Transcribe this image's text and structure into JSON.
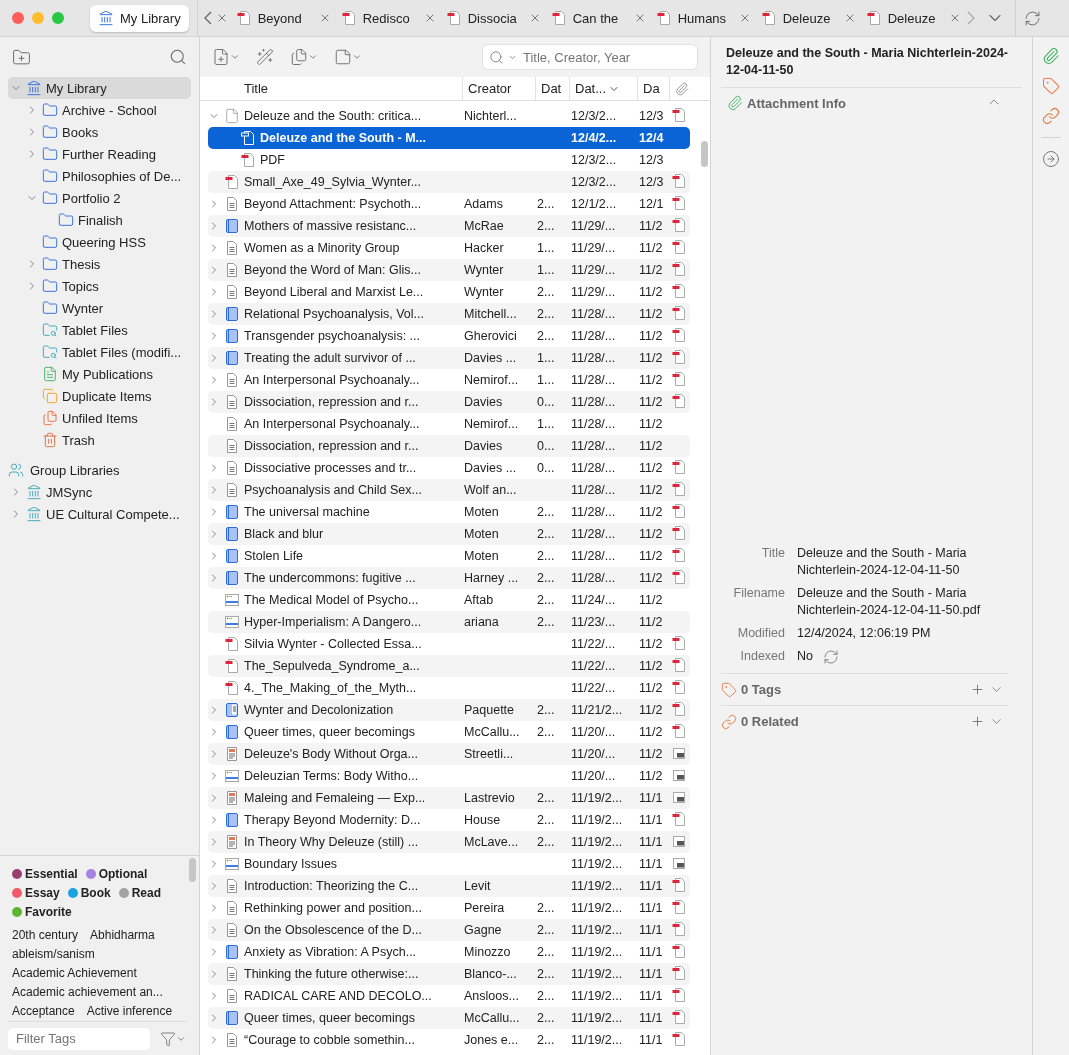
{
  "tabs": [
    {
      "label": "My Library",
      "kind": "library",
      "selected": true
    },
    {
      "label": "Beyond",
      "kind": "pdf",
      "selected": false
    },
    {
      "label": "Redisco",
      "kind": "pdf",
      "selected": false
    },
    {
      "label": "Dissocia",
      "kind": "pdf",
      "selected": false
    },
    {
      "label": "Can the",
      "kind": "pdf",
      "selected": false
    },
    {
      "label": "Humans",
      "kind": "pdf",
      "selected": false
    },
    {
      "label": "Deleuze",
      "kind": "pdf",
      "selected": false
    },
    {
      "label": "Deleuze",
      "kind": "pdf",
      "selected": false
    }
  ],
  "collections": [
    {
      "label": "My Library",
      "kind": "library",
      "selected": true,
      "expanded": true,
      "children": [
        {
          "label": "Archive - School",
          "kind": "folder",
          "selected": false,
          "expanded": false
        },
        {
          "label": "Books",
          "kind": "folder",
          "selected": false,
          "expanded": false
        },
        {
          "label": "Further Reading",
          "kind": "folder",
          "selected": false,
          "expanded": false
        },
        {
          "label": "Philosophies of De...",
          "kind": "folder",
          "selected": false
        },
        {
          "label": "Portfolio 2",
          "kind": "folder",
          "selected": false,
          "expanded": true,
          "children": [
            {
              "label": "Finalish",
              "kind": "folder",
              "selected": false
            }
          ]
        },
        {
          "label": "Queering HSS",
          "kind": "folder",
          "selected": false
        },
        {
          "label": "Thesis",
          "kind": "folder",
          "selected": false,
          "expanded": false
        },
        {
          "label": "Topics",
          "kind": "folder",
          "selected": false,
          "expanded": false
        },
        {
          "label": "Wynter",
          "kind": "folder",
          "selected": false
        },
        {
          "label": "Tablet Files",
          "kind": "saved-search",
          "selected": false
        },
        {
          "label": "Tablet Files (modifi...",
          "kind": "saved-search",
          "selected": false
        },
        {
          "label": "My Publications",
          "kind": "publications",
          "selected": false
        },
        {
          "label": "Duplicate Items",
          "kind": "duplicates",
          "selected": false
        },
        {
          "label": "Unfiled Items",
          "kind": "unfiled",
          "selected": false
        },
        {
          "label": "Trash",
          "kind": "trash",
          "selected": false
        }
      ]
    }
  ],
  "group_libraries": {
    "label": "Group Libraries",
    "items": [
      {
        "label": "JMSync",
        "selected": false,
        "expanded": false
      },
      {
        "label": "UE Cultural Compete...",
        "selected": false,
        "expanded": false
      }
    ]
  },
  "tag_selector": {
    "colored_tags": [
      {
        "label": "Essential",
        "color": "#9c3d72"
      },
      {
        "label": "Optional",
        "color": "#a584e0"
      },
      {
        "label": "Essay",
        "color": "#f25c68"
      },
      {
        "label": "Book",
        "color": "#1aa3e0"
      },
      {
        "label": "Read",
        "color": "#a3a3a3"
      },
      {
        "label": "Favorite",
        "color": "#5cb532"
      }
    ],
    "tags": [
      "20th century",
      "Abhidharma",
      "ableism/sanism",
      "Academic Achievement",
      "Academic achievement an...",
      "Acceptance",
      "Active inference"
    ],
    "filter": {
      "placeholder": "Filter Tags"
    }
  },
  "items": {
    "search": {
      "placeholder": "Title, Creator, Year"
    },
    "columns": [
      {
        "label": "Title",
        "sorted": false
      },
      {
        "label": "Creator",
        "sorted": false
      },
      {
        "label": "Dat",
        "sorted": false
      },
      {
        "label": "Dat...",
        "sorted": true
      },
      {
        "label": "Da",
        "sorted": false
      }
    ],
    "rows": [
      {
        "title": "Deleuze and the South: critica...",
        "creator": "Nichterl...",
        "column_4": "12/3/2...",
        "column_5": "12/3",
        "kind": "page",
        "attachment": {
          "kind": "pdf"
        },
        "selected": false,
        "expanded": true,
        "children": [
          {
            "title": "Deleuze and the South - M...",
            "column_4": "12/4/2...",
            "column_5": "12/4",
            "kind": "pdf",
            "selected": true
          },
          {
            "title": "PDF",
            "column_4": "12/3/2...",
            "column_5": "12/3",
            "kind": "pdf",
            "selected": false
          }
        ]
      },
      {
        "title": "Small_Axe_49_Sylvia_Wynter...",
        "column_4": "12/3/2...",
        "column_5": "12/3",
        "kind": "pdf",
        "attachment": {
          "kind": "pdf"
        },
        "selected": false
      },
      {
        "title": "Beyond Attachment: Psychoth...",
        "creator": "Adams",
        "column_3": "2...",
        "column_4": "12/1/2...",
        "column_5": "12/1",
        "kind": "document",
        "attachment": {
          "kind": "pdf"
        },
        "selected": false,
        "expanded": false
      },
      {
        "title": "Mothers of massive resistanc...",
        "creator": "McRae",
        "column_3": "2...",
        "column_4": "11/29/...",
        "column_5": "11/2",
        "kind": "book",
        "attachment": {
          "kind": "pdf"
        },
        "selected": false,
        "expanded": false
      },
      {
        "title": "Women as a Minority Group",
        "creator": "Hacker",
        "column_3": "1...",
        "column_4": "11/29/...",
        "column_5": "11/2",
        "kind": "document",
        "attachment": {
          "kind": "pdf"
        },
        "selected": false,
        "expanded": false
      },
      {
        "title": "Beyond the Word of Man: Glis...",
        "creator": "Wynter",
        "column_3": "1...",
        "column_4": "11/29/...",
        "column_5": "11/2",
        "kind": "document",
        "attachment": {
          "kind": "pdf"
        },
        "selected": false,
        "expanded": false
      },
      {
        "title": "Beyond Liberal and Marxist Le...",
        "creator": "Wynter",
        "column_3": "2...",
        "column_4": "11/29/...",
        "column_5": "11/2",
        "kind": "document",
        "attachment": {
          "kind": "pdf"
        },
        "selected": false,
        "expanded": false
      },
      {
        "title": "Relational Psychoanalysis, Vol...",
        "creator": "Mitchell...",
        "column_3": "2...",
        "column_4": "11/28/...",
        "column_5": "11/2",
        "kind": "book",
        "attachment": {
          "kind": "pdf"
        },
        "selected": false,
        "expanded": false
      },
      {
        "title": "Transgender psychoanalysis: ...",
        "creator": "Gherovici",
        "column_3": "2...",
        "column_4": "11/28/...",
        "column_5": "11/2",
        "kind": "book",
        "attachment": {
          "kind": "pdf"
        },
        "selected": false,
        "expanded": false
      },
      {
        "title": "Treating the adult survivor of ...",
        "creator": "Davies ...",
        "column_3": "1...",
        "column_4": "11/28/...",
        "column_5": "11/2",
        "kind": "book",
        "attachment": {
          "kind": "pdf"
        },
        "selected": false,
        "expanded": false
      },
      {
        "title": "An Interpersonal Psychoanaly...",
        "creator": "Nemirof...",
        "column_3": "1...",
        "column_4": "11/28/...",
        "column_5": "11/2",
        "kind": "document",
        "attachment": {
          "kind": "pdf"
        },
        "selected": false,
        "expanded": false
      },
      {
        "title": "Dissociation, repression and r...",
        "creator": "Davies",
        "column_3": "0...",
        "column_4": "11/28/...",
        "column_5": "11/2",
        "kind": "document",
        "attachment": {
          "kind": "pdf"
        },
        "selected": false,
        "expanded": false
      },
      {
        "title": "An Interpersonal Psychoanaly...",
        "creator": "Nemirof...",
        "column_3": "1...",
        "column_4": "11/28/...",
        "column_5": "11/2",
        "kind": "document",
        "selected": false
      },
      {
        "title": "Dissociation, repression and r...",
        "creator": "Davies",
        "column_3": "0...",
        "column_4": "11/28/...",
        "column_5": "11/2",
        "kind": "document",
        "selected": false
      },
      {
        "title": "Dissociative processes and tr...",
        "creator": "Davies ...",
        "column_3": "0...",
        "column_4": "11/28/...",
        "column_5": "11/2",
        "kind": "document",
        "attachment": {
          "kind": "pdf"
        },
        "selected": false,
        "expanded": false
      },
      {
        "title": "Psychoanalysis and Child Sex...",
        "creator": "Wolf an...",
        "column_4": "11/28/...",
        "column_5": "11/2",
        "kind": "document",
        "attachment": {
          "kind": "pdf"
        },
        "selected": false,
        "expanded": false
      },
      {
        "title": "The universal machine",
        "creator": "Moten",
        "column_3": "2...",
        "column_4": "11/28/...",
        "column_5": "11/2",
        "kind": "book",
        "attachment": {
          "kind": "pdf"
        },
        "selected": false,
        "expanded": false
      },
      {
        "title": "Black and blur",
        "creator": "Moten",
        "column_3": "2...",
        "column_4": "11/28/...",
        "column_5": "11/2",
        "kind": "book",
        "attachment": {
          "kind": "pdf"
        },
        "selected": false,
        "expanded": false
      },
      {
        "title": "Stolen Life",
        "creator": "Moten",
        "column_3": "2...",
        "column_4": "11/28/...",
        "column_5": "11/2",
        "kind": "book",
        "attachment": {
          "kind": "pdf"
        },
        "selected": false,
        "expanded": false
      },
      {
        "title": "The undercommons: fugitive ...",
        "creator": "Harney ...",
        "column_3": "2...",
        "column_4": "11/28/...",
        "column_5": "11/2",
        "kind": "book",
        "attachment": {
          "kind": "pdf"
        },
        "selected": false,
        "expanded": false
      },
      {
        "title": "The Medical Model of Psycho...",
        "creator": "Aftab",
        "column_3": "2...",
        "column_4": "11/24/...",
        "column_5": "11/2",
        "kind": "webpage",
        "selected": false
      },
      {
        "title": "Hyper-Imperialism: A Dangero...",
        "creator": "ariana",
        "column_3": "2...",
        "column_4": "11/23/...",
        "column_5": "11/2",
        "kind": "webpage",
        "selected": false
      },
      {
        "title": "Silvia Wynter - Collected Essa...",
        "column_4": "11/22/...",
        "column_5": "11/2",
        "kind": "pdf",
        "attachment": {
          "kind": "pdf"
        },
        "selected": false
      },
      {
        "title": "The_Sepulveda_Syndrome_a...",
        "column_4": "11/22/...",
        "column_5": "11/2",
        "kind": "pdf",
        "attachment": {
          "kind": "pdf"
        },
        "selected": false
      },
      {
        "title": "4._The_Making_of_the_Myth...",
        "column_4": "11/22/...",
        "column_5": "11/2",
        "kind": "pdf",
        "attachment": {
          "kind": "pdf"
        },
        "selected": false
      },
      {
        "title": "Wynter and Decolonization",
        "creator": "Paquette",
        "column_3": "2...",
        "column_4": "11/21/2...",
        "column_5": "11/2",
        "kind": "book-section",
        "attachment": {
          "kind": "pdf"
        },
        "selected": false,
        "expanded": false
      },
      {
        "title": "Queer times, queer becomings",
        "creator": "McCallu...",
        "column_3": "2...",
        "column_4": "11/20/...",
        "column_5": "11/2",
        "kind": "book",
        "attachment": {
          "kind": "pdf"
        },
        "selected": false,
        "expanded": false
      },
      {
        "title": "Deleuze's Body Without Orga...",
        "creator": "Streetli...",
        "column_4": "11/20/...",
        "column_5": "11/2",
        "kind": "post",
        "attachment": {
          "kind": "snapshot"
        },
        "selected": false,
        "expanded": false
      },
      {
        "title": "Deleuzian Terms: Body Witho...",
        "column_4": "11/20/...",
        "column_5": "11/2",
        "kind": "webpage",
        "attachment": {
          "kind": "snapshot"
        },
        "selected": false,
        "expanded": false
      },
      {
        "title": "Maleing and Femaleing — Exp...",
        "creator": "Lastrevio",
        "column_3": "2...",
        "column_4": "11/19/2...",
        "column_5": "11/1",
        "kind": "post",
        "attachment": {
          "kind": "snapshot"
        },
        "selected": false,
        "expanded": false
      },
      {
        "title": "Therapy Beyond Modernity: D...",
        "creator": "House",
        "column_3": "2...",
        "column_4": "11/19/2...",
        "column_5": "11/1",
        "kind": "book",
        "attachment": {
          "kind": "pdf"
        },
        "selected": false,
        "expanded": false
      },
      {
        "title": "In Theory Why Deleuze (still) ...",
        "creator": "McLave...",
        "column_3": "2...",
        "column_4": "11/19/2...",
        "column_5": "11/1",
        "kind": "post",
        "attachment": {
          "kind": "snapshot"
        },
        "selected": false,
        "expanded": false
      },
      {
        "title": "Boundary Issues",
        "column_4": "11/19/2...",
        "column_5": "11/1",
        "kind": "webpage",
        "attachment": {
          "kind": "snapshot"
        },
        "selected": false,
        "expanded": false
      },
      {
        "title": "Introduction: Theorizing the C...",
        "creator": "Levit",
        "column_4": "11/19/2...",
        "column_5": "11/1",
        "kind": "document",
        "attachment": {
          "kind": "pdf"
        },
        "selected": false,
        "expanded": false
      },
      {
        "title": "Rethinking power and position...",
        "creator": "Pereira",
        "column_3": "2...",
        "column_4": "11/19/2...",
        "column_5": "11/1",
        "kind": "document",
        "attachment": {
          "kind": "pdf"
        },
        "selected": false,
        "expanded": false
      },
      {
        "title": "On the Obsolescence of the D...",
        "creator": "Gagne",
        "column_3": "2...",
        "column_4": "11/19/2...",
        "column_5": "11/1",
        "kind": "document",
        "attachment": {
          "kind": "pdf"
        },
        "selected": false,
        "expanded": false
      },
      {
        "title": "Anxiety as Vibration: A Psych...",
        "creator": "Minozzo",
        "column_3": "2...",
        "column_4": "11/19/2...",
        "column_5": "11/1",
        "kind": "book",
        "attachment": {
          "kind": "pdf"
        },
        "selected": false,
        "expanded": false
      },
      {
        "title": "Thinking the future otherwise:...",
        "creator": "Blanco-...",
        "column_3": "2...",
        "column_4": "11/19/2...",
        "column_5": "11/1",
        "kind": "document",
        "attachment": {
          "kind": "pdf"
        },
        "selected": false,
        "expanded": false
      },
      {
        "title": "RADICAL CARE AND DECOLO...",
        "creator": "Ansloos...",
        "column_3": "2...",
        "column_4": "11/19/2...",
        "column_5": "11/1",
        "kind": "document",
        "attachment": {
          "kind": "pdf"
        },
        "selected": false,
        "expanded": false
      },
      {
        "title": "Queer times, queer becomings",
        "creator": "McCallu...",
        "column_3": "2...",
        "column_4": "11/19/2...",
        "column_5": "11/1",
        "kind": "book",
        "attachment": {
          "kind": "pdf"
        },
        "selected": false,
        "expanded": false
      },
      {
        "title": "“Courage to cobble somethin...",
        "creator": "Jones e...",
        "column_3": "2...",
        "column_4": "11/19/2...",
        "column_5": "11/1",
        "kind": "document",
        "attachment": {
          "kind": "pdf"
        },
        "selected": false,
        "expanded": false
      }
    ]
  },
  "item_pane": {
    "header": "Deleuze and the South - Maria Nichterlein-2024-12-04-11-50",
    "attachment_info": {
      "label": "Attachment Info",
      "expanded": true,
      "fields": [
        {
          "label": "Title",
          "value": "Deleuze and the South - Maria Nichterlein-2024-12-04-11-50"
        },
        {
          "label": "Filename",
          "value": "Deleuze and the South - Maria Nichterlein-2024-12-04-11-50.pdf"
        },
        {
          "label": "Modified",
          "value": "12/4/2024, 12:06:19 PM"
        },
        {
          "label": "Indexed",
          "value": "No"
        }
      ]
    },
    "tags": {
      "label": "0 Tags",
      "expanded": false
    },
    "related": {
      "label": "0 Related",
      "expanded": false
    }
  }
}
